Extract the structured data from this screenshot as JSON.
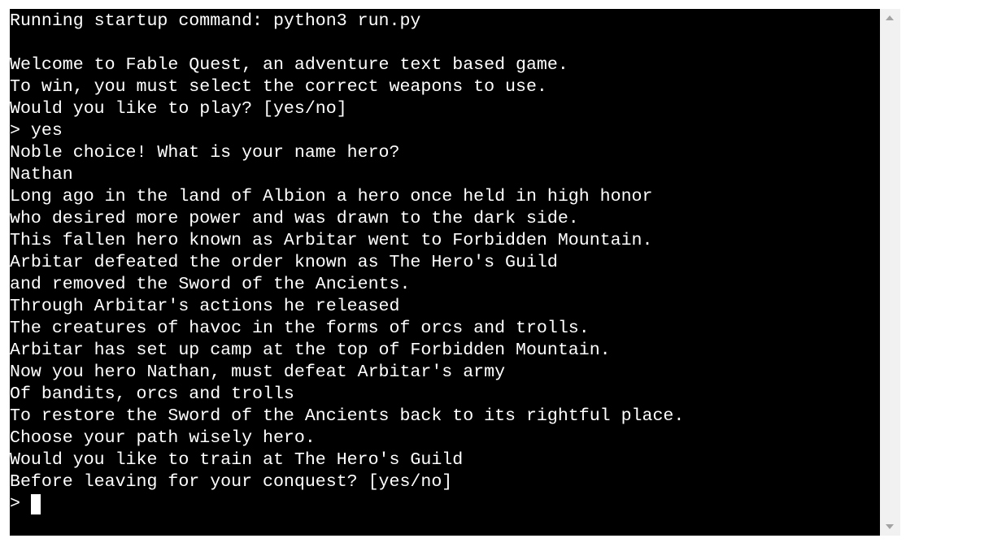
{
  "terminal": {
    "lines": [
      "Running startup command: python3 run.py",
      "",
      "Welcome to Fable Quest, an adventure text based game.",
      "To win, you must select the correct weapons to use.",
      "Would you like to play? [yes/no]",
      "> yes",
      "Noble choice! What is your name hero?",
      "Nathan",
      "Long ago in the land of Albion a hero once held in high honor",
      "who desired more power and was drawn to the dark side.",
      "This fallen hero known as Arbitar went to Forbidden Mountain.",
      "Arbitar defeated the order known as The Hero's Guild",
      "and removed the Sword of the Ancients.",
      "Through Arbitar's actions he released",
      "The creatures of havoc in the forms of orcs and trolls.",
      "Arbitar has set up camp at the top of Forbidden Mountain.",
      "Now you hero Nathan, must defeat Arbitar's army",
      "Of bandits, orcs and trolls",
      "To restore the Sword of the Ancients back to its rightful place.",
      "Choose your path wisely hero.",
      "Would you like to train at The Hero's Guild",
      "Before leaving for your conquest? [yes/no]"
    ],
    "prompt": "> ",
    "colors": {
      "background": "#000000",
      "text": "#ffffff",
      "scrollbar_track": "#f1f1f1",
      "scrollbar_arrow": "#a3a3a3"
    },
    "icons": {
      "scroll_up": "triangle-up-icon",
      "scroll_down": "triangle-down-icon",
      "cursor": "block-cursor"
    }
  }
}
